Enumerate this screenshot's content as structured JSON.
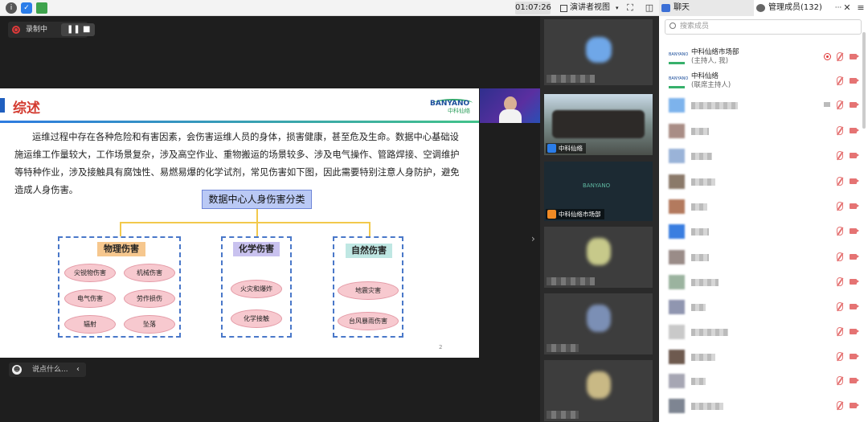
{
  "topbar": {
    "timer": "01:07:26",
    "view_label": "演讲者视图",
    "chat_tab": "聊天",
    "members_tab": "管理成员(132)",
    "menu": "≡",
    "more": "···",
    "close": "✕"
  },
  "recording": {
    "label": "录制中"
  },
  "slide": {
    "title": "综述",
    "logo_text": "BANYANO",
    "logo_sub": "中科仙络",
    "paragraph": "运维过程中存在各种危险和有害因素，会伤害运维人员的身体，损害健康，甚至危及生命。数据中心基础设施运维工作量较大，工作场景复杂，涉及高空作业、重物搬运的场景较多、涉及电气操作、管路焊接、空调维护等特种作业，涉及接触具有腐蚀性、易燃易爆的化学试剂，常见伤害如下图，因此需要特别注意人身防护，避免造成人身伤害。",
    "root": "数据中心人身伤害分类",
    "categories": [
      {
        "name": "物理伤害",
        "items": [
          "尖锐物伤害",
          "机械伤害",
          "电气伤害",
          "劳作损伤",
          "辐射",
          "坠落"
        ]
      },
      {
        "name": "化学伤害",
        "items": [
          "火灾和爆炸",
          "化学接触"
        ]
      },
      {
        "name": "自然伤害",
        "items": [
          "地震灾害",
          "台风暴雨伤害"
        ]
      }
    ],
    "page_number": "2"
  },
  "chat": {
    "placeholder": "说点什么..."
  },
  "video_tiles": [
    {
      "name": ""
    },
    {
      "name": "中科仙络"
    },
    {
      "name": "中科仙络市场部"
    },
    {
      "name": ""
    },
    {
      "name": ""
    },
    {
      "name": ""
    }
  ],
  "members": {
    "search_placeholder": "搜索成员",
    "list": [
      {
        "name": "中科仙络市场部",
        "role": "(主持人, 我)"
      },
      {
        "name": "中科仙络",
        "role": "(联席主持人)"
      }
    ]
  }
}
